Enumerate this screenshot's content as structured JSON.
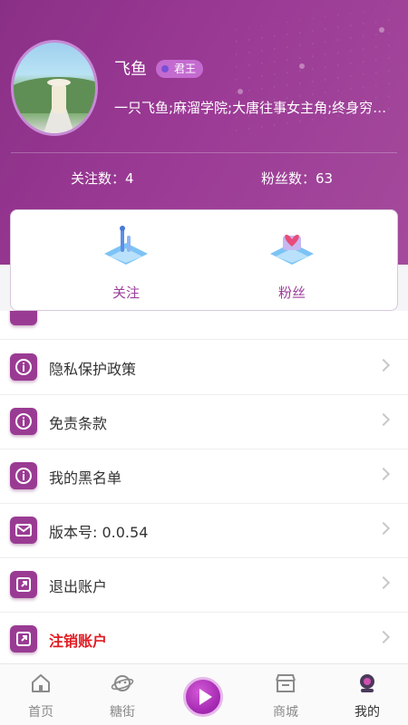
{
  "profile": {
    "name": "飞鱼",
    "badge": "君王",
    "bio": "一只飞鱼;麻溜学院;大唐往事女主角;终身穷的...",
    "following_text": "关注数：4",
    "followers_text": "粉丝数：63"
  },
  "card": {
    "items": [
      {
        "label": "关注",
        "icon": "follow-icon"
      },
      {
        "label": "粉丝",
        "icon": "fans-icon"
      }
    ]
  },
  "menu": {
    "items": [
      {
        "label": "隐私保护政策",
        "icon": "info-icon"
      },
      {
        "label": "免责条款",
        "icon": "info-icon"
      },
      {
        "label": "我的黑名单",
        "icon": "info-icon"
      },
      {
        "label": "版本号: 0.0.54",
        "icon": "mail-icon"
      },
      {
        "label": "退出账户",
        "icon": "exit-icon"
      },
      {
        "label": "注销账户",
        "icon": "exit-icon"
      }
    ]
  },
  "tabbar": {
    "items": [
      {
        "label": "首页",
        "icon": "home-icon"
      },
      {
        "label": "糖街",
        "icon": "planet-icon"
      },
      {
        "label": "",
        "icon": "play-icon"
      },
      {
        "label": "商城",
        "icon": "shop-icon"
      },
      {
        "label": "我的",
        "icon": "mine-icon"
      }
    ]
  },
  "colors": {
    "brand": "#9a3b93",
    "danger": "#e11b22"
  }
}
